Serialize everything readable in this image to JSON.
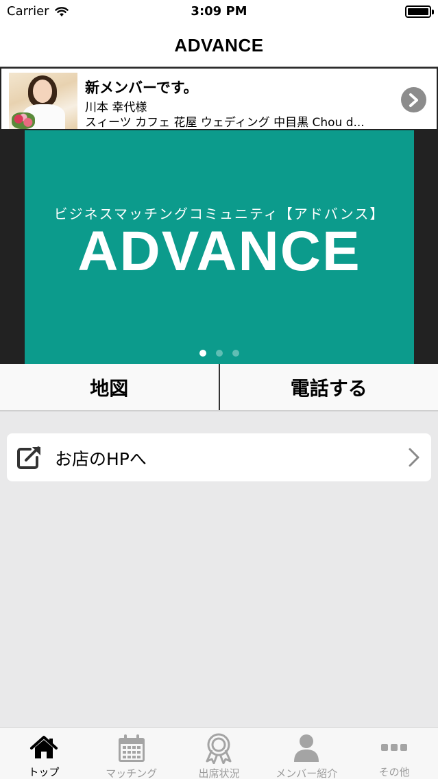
{
  "status_bar": {
    "carrier": "Carrier",
    "time": "3:09 PM",
    "battery_level": 1.0
  },
  "nav": {
    "title": "ADVANCE"
  },
  "banner": {
    "title": "新メンバーです。",
    "name": "川本 幸代様",
    "tags": "スィーツ カフェ 花屋 ウェディング 中目黒 Chou d...",
    "arrow_icon": "chevron-right-circle-icon"
  },
  "hero": {
    "subtitle": "ビジネスマッチングコミュニティ【アドバンス】",
    "brand": "ADVANCE",
    "background_color": "#0c9b8c",
    "page_count": 3,
    "active_page": 1
  },
  "actions": {
    "map_label": "地図",
    "call_label": "電話する"
  },
  "hp_link": {
    "label": "お店のHPへ",
    "icon": "external-link-icon"
  },
  "tabs": [
    {
      "label": "トップ",
      "icon": "home-icon",
      "active": true
    },
    {
      "label": "マッチング",
      "icon": "calendar-icon",
      "active": false
    },
    {
      "label": "出席状況",
      "icon": "award-ribbon-icon",
      "active": false
    },
    {
      "label": "メンバー紹介",
      "icon": "person-icon",
      "active": false
    },
    {
      "label": "その他",
      "icon": "more-dots-icon",
      "active": false
    }
  ]
}
